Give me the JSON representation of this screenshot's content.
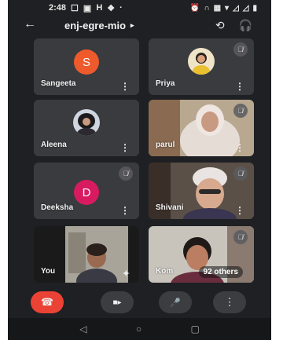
{
  "status_bar": {
    "time": "2:48",
    "left_icons": [
      "☐",
      "▣",
      "H",
      "❖",
      "·"
    ],
    "right_icons": [
      "⏰",
      "∩",
      "▦",
      "▾",
      "◿",
      "◿",
      "▮"
    ]
  },
  "app_bar": {
    "back_glyph": "←",
    "meeting_code": "enj-egre-mio",
    "caret": "▸",
    "switch_camera_glyph": "⟲",
    "audio_glyph": "🎧"
  },
  "participants": [
    {
      "name": "Sangeeta",
      "avatar_letter": "S",
      "avatar_color": "#ee5a2c",
      "muted": false
    },
    {
      "name": "Priya",
      "muted": true
    },
    {
      "name": "Aleena",
      "muted": false
    },
    {
      "name": "parul",
      "muted": true
    },
    {
      "name": "Deeksha",
      "avatar_letter": "D",
      "avatar_color": "#d81b60",
      "muted": true
    },
    {
      "name": "Shivani",
      "muted": true
    },
    {
      "name": "You",
      "muted": false
    },
    {
      "name": "Kom",
      "muted": true
    }
  ],
  "others_badge": "92 others",
  "more_glyph": "⋮",
  "mute_glyph": "🎙̸",
  "controls": {
    "end_call_glyph": "☎",
    "camera_glyph": "■▸",
    "mic_glyph": "🎤",
    "more_glyph": "⋮"
  },
  "nav": {
    "back": "◁",
    "home": "○",
    "recents": "▢"
  },
  "colors": {
    "background": "#1f2023",
    "tile": "#3a3b3f",
    "end_call": "#ea4335"
  }
}
